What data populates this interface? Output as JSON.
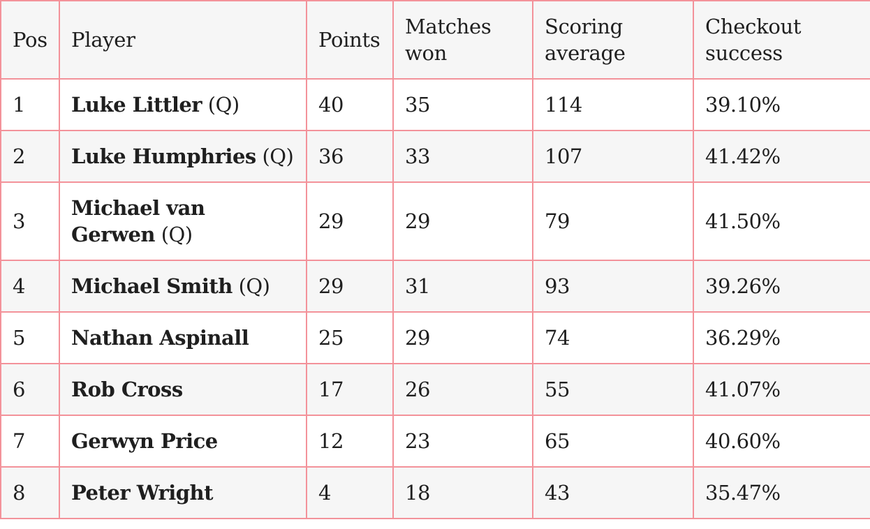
{
  "table": {
    "headers": {
      "pos": "Pos",
      "player": "Player",
      "points": "Points",
      "matches_won": "Matches won",
      "scoring_average": "Scoring average",
      "checkout_success": "Checkout success"
    },
    "rows": [
      {
        "pos": "1",
        "player": "Luke Littler",
        "qualifier": "(Q)",
        "points": "40",
        "matches_won": "35",
        "scoring_average": "114",
        "checkout_success": "39.10%"
      },
      {
        "pos": "2",
        "player": "Luke Humphries",
        "qualifier": "(Q)",
        "points": "36",
        "matches_won": "33",
        "scoring_average": "107",
        "checkout_success": "41.42%"
      },
      {
        "pos": "3",
        "player": "Michael van Gerwen",
        "qualifier": "(Q)",
        "points": "29",
        "matches_won": "29",
        "scoring_average": "79",
        "checkout_success": "41.50%"
      },
      {
        "pos": "4",
        "player": "Michael Smith",
        "qualifier": "(Q)",
        "points": "29",
        "matches_won": "31",
        "scoring_average": "93",
        "checkout_success": "39.26%"
      },
      {
        "pos": "5",
        "player": "Nathan Aspinall",
        "qualifier": "",
        "points": "25",
        "matches_won": "29",
        "scoring_average": "74",
        "checkout_success": "36.29%"
      },
      {
        "pos": "6",
        "player": "Rob Cross",
        "qualifier": "",
        "points": "17",
        "matches_won": "26",
        "scoring_average": "55",
        "checkout_success": "41.07%"
      },
      {
        "pos": "7",
        "player": "Gerwyn Price",
        "qualifier": "",
        "points": "12",
        "matches_won": "23",
        "scoring_average": "65",
        "checkout_success": "40.60%"
      },
      {
        "pos": "8",
        "player": "Peter Wright",
        "qualifier": "",
        "points": "4",
        "matches_won": "18",
        "scoring_average": "43",
        "checkout_success": "35.47%"
      }
    ]
  },
  "colors": {
    "border": "#f3929a",
    "header_bg": "#f6f6f6",
    "stripe_bg": "#f6f6f6",
    "text": "#1f1f1f"
  }
}
